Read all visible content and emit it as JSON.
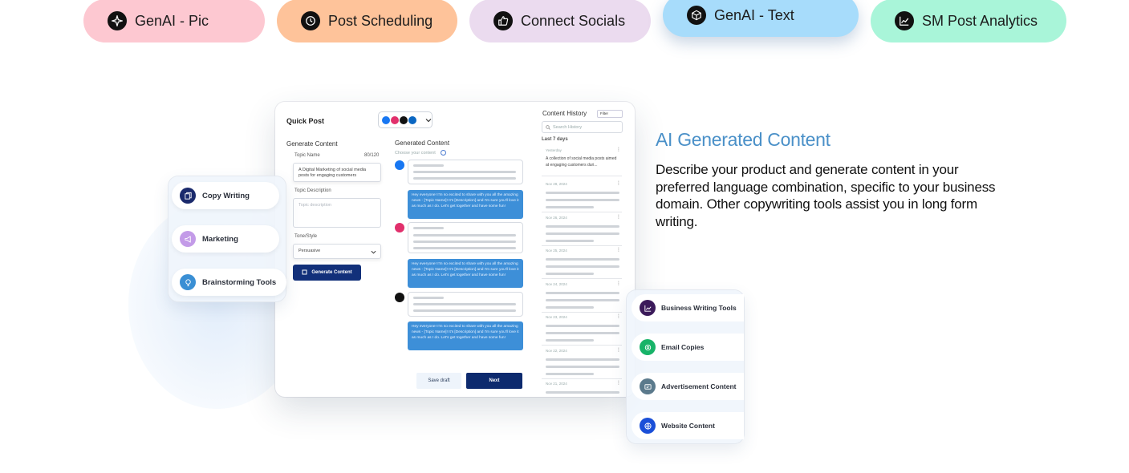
{
  "tabs": [
    {
      "label": "GenAI - Pic",
      "color": "#fdc8d1",
      "icon": "sparkle-icon"
    },
    {
      "label": "Post Scheduling",
      "color": "#fec39a",
      "icon": "clock-icon"
    },
    {
      "label": "Connect Socials",
      "color": "#ebdbef",
      "icon": "thumbs-up-icon"
    },
    {
      "label": "GenAI - Text",
      "color": "#a7dcfb",
      "icon": "cube-icon",
      "active": true
    },
    {
      "label": "SM Post Analytics",
      "color": "#a9f5d9",
      "icon": "chart-line-icon"
    }
  ],
  "mockup": {
    "title": "Quick Post",
    "generate_content_heading": "Generate Content",
    "topic_name_label": "Topic Name",
    "topic_count": "80/120",
    "topic_name_value": "A Digital Marketing of social media posts for engaging customers",
    "topic_description_label": "Topic Description",
    "topic_description_placeholder": "Topic description",
    "tone_label": "Tone/Style",
    "tone_value": "Persuasive",
    "generate_button": "Generate Content",
    "generated_heading": "Generated Content",
    "choose_label": "Choose your content",
    "bubble_text": "Hey everyone!\nI'm so excited to share with you all the amazing news - [Topic Name]! It's [Description] and I'm sure you'll love it as much as I do. Let's get together and have some fun!",
    "history_title": "Content History",
    "history_filter": "Filter",
    "search_placeholder": "Search History",
    "last_days": "Last 7 days",
    "history_first_date": "Yesterday",
    "history_first_text": "A collection of social media posts aimed at engaging customers duri...",
    "history_dates": [
      "Nov 28, 2024",
      "Nov 26, 2024",
      "Nov 25, 2024",
      "Nov 24, 2024",
      "Nov 23, 2024",
      "Nov 22, 2024",
      "Nov 21, 2024"
    ],
    "save_draft": "Save draft",
    "next": "Next"
  },
  "left_card": [
    {
      "label": "Copy Writing",
      "color": "#1a2a6c",
      "icon": "copy-icon"
    },
    {
      "label": "Marketing",
      "color": "#c39be8",
      "icon": "megaphone-icon"
    },
    {
      "label": "Brainstorming Tools",
      "color": "#3a8fd4",
      "icon": "lightbulb-icon"
    }
  ],
  "right_card": [
    {
      "label": "Business Writing Tools",
      "color": "#3b1a5a",
      "icon": "chart-icon"
    },
    {
      "label": "Email Copies",
      "color": "#18b368",
      "icon": "email-icon"
    },
    {
      "label": "Advertisement Content",
      "color": "#5b7a8c",
      "icon": "ad-icon"
    },
    {
      "label": "Website Content",
      "color": "#1a4fd8",
      "icon": "globe-icon"
    }
  ],
  "content": {
    "title": "AI Generated Content",
    "description": "Describe your product and generate content in your preferred language combination, specific to your business domain. Other copywriting tools assist you in long form writing."
  }
}
